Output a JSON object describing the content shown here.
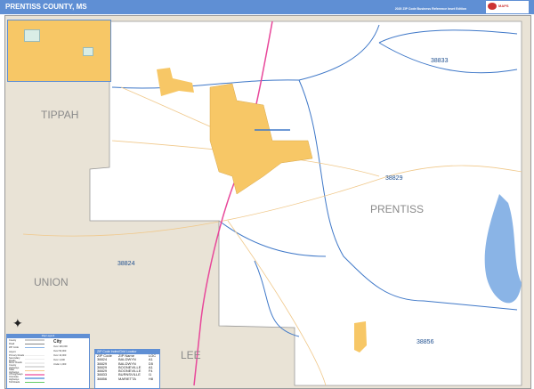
{
  "header": {
    "title": "PRENTISS COUNTY, MS",
    "subtitle": "2020 ZIP Code Business Reference Inset Edition",
    "logo_text": "MAPS"
  },
  "map": {
    "county_labels": [
      "TIPPAH",
      "PRENTISS",
      "UNION",
      "LEE"
    ],
    "zip_labels": [
      "38833",
      "38829",
      "38824",
      "38856"
    ],
    "colors": {
      "city": "#f7c766",
      "water": "#8ab4e6",
      "zip_boundary": "#3f78c8",
      "neighbor": "#e9e3d6",
      "highway": "#e8479a"
    }
  },
  "legend": {
    "title": "Map Legend",
    "rows": [
      "County",
      "Road",
      "ZIP Code",
      "Airport",
      "Primary Roads",
      "Secondary Roads",
      "Minor Roads",
      "County Highways",
      "State Highways",
      "US Highways",
      "Interstate Highways",
      "Toll Roads"
    ],
    "city_symbol": "City",
    "population": [
      "Over 100,000",
      "Over 50,000",
      "Over 10,000",
      "Over 1,000",
      "Under 1,000"
    ]
  },
  "zip_table": {
    "title": "ZIP Code Index/Grid Locator",
    "columns": [
      "ZIP Code",
      "ZIP Name",
      "LOC"
    ],
    "rows": [
      [
        "38824",
        "BALDWYN",
        "A1"
      ],
      [
        "38829",
        "BALDWYN",
        "D5"
      ],
      [
        "38829",
        "BOONEVILLE",
        "A1"
      ],
      [
        "38829",
        "BOONEVILLE",
        "F4"
      ],
      [
        "38833",
        "BURNSVILLE",
        "I1"
      ],
      [
        "38856",
        "MARIETTA",
        "H8"
      ]
    ]
  }
}
